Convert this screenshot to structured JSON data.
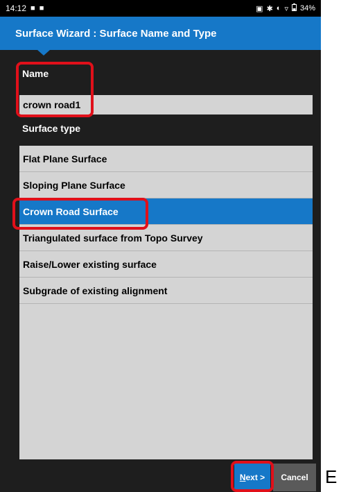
{
  "statusbar": {
    "time": "14:12",
    "left_icons": [
      "■",
      "■"
    ],
    "right_icons": [
      "▣",
      "✱",
      "◐",
      "▿"
    ],
    "battery": "34%"
  },
  "wizard": {
    "title": "Surface Wizard : Surface Name and Type"
  },
  "name_section": {
    "label": "Name",
    "value": "crown road1"
  },
  "type_section": {
    "label": "Surface type",
    "items": [
      {
        "label": "Flat Plane Surface"
      },
      {
        "label": "Sloping Plane Surface"
      },
      {
        "label": "Crown Road Surface"
      },
      {
        "label": "Triangulated surface from Topo Survey"
      },
      {
        "label": "Raise/Lower existing surface"
      },
      {
        "label": "Subgrade of existing alignment"
      }
    ],
    "selected_index": 2
  },
  "buttons": {
    "next_mnemonic": "N",
    "next_rest": "ext >",
    "cancel": "Cancel"
  },
  "side_letter": "E",
  "colors": {
    "accent": "#1678c8",
    "highlight": "#e0101a"
  }
}
